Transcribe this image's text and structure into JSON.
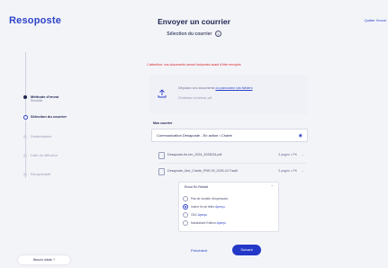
{
  "app": {
    "logo": "Resoposte",
    "quit_label": "Quitter l'envoi"
  },
  "header": {
    "title": "Envoyer un courrier",
    "subtitle": "Sélection du courrier",
    "info_glyph": "i"
  },
  "stepper": {
    "steps": [
      {
        "label": "Méthode d'envoi",
        "sub": "Recueille",
        "state": "done"
      },
      {
        "label": "Sélection du courrier",
        "state": "current"
      },
      {
        "label": "Destinataires",
        "state": "todo"
      },
      {
        "label": "Date de diffusion",
        "state": "todo"
      },
      {
        "label": "Récapitulatif",
        "state": "todo"
      }
    ]
  },
  "help": {
    "label": "Besoin d'aide ?"
  },
  "warning": "L'attention: vos documents seront fusionnés avant d'être envoyés",
  "dropzone": {
    "text": "Déposez vos documents",
    "link": "ou parcourez vos fichiers",
    "hint": "Choisissez un format .pdf"
  },
  "courrier": {
    "label": "Mon courrier",
    "value": "Communication Desaposte - En action • Charte",
    "eye_icon": "eye-icon"
  },
  "files": [
    {
      "name": "Desaposte-lfo-hm_2024_2025024.pdf",
      "meta": "3 pages • PK"
    },
    {
      "name": "Desaposte_Mut_Charte_PNE-09_2025-24 Tradit",
      "meta": "3 pages • PK"
    }
  ],
  "options_panel": {
    "title": "Envoi En Retrait",
    "options": [
      {
        "label": "Pas de modèle d'impression",
        "apercu": "",
        "selected": false
      },
      {
        "label": "Insère fin de lettre",
        "apercu": "Aperçu",
        "selected": true
      },
      {
        "label": "CBC",
        "apercu": "Aperçu",
        "selected": false
      },
      {
        "label": "Mandataire Editeur",
        "apercu": "Aperçu",
        "selected": false
      }
    ]
  },
  "actions": {
    "prev": "Précédent",
    "next": "Suivant"
  },
  "colors": {
    "brand": "#2d44c9",
    "primary_button": "#2338c7",
    "warning": "#d6262c"
  }
}
